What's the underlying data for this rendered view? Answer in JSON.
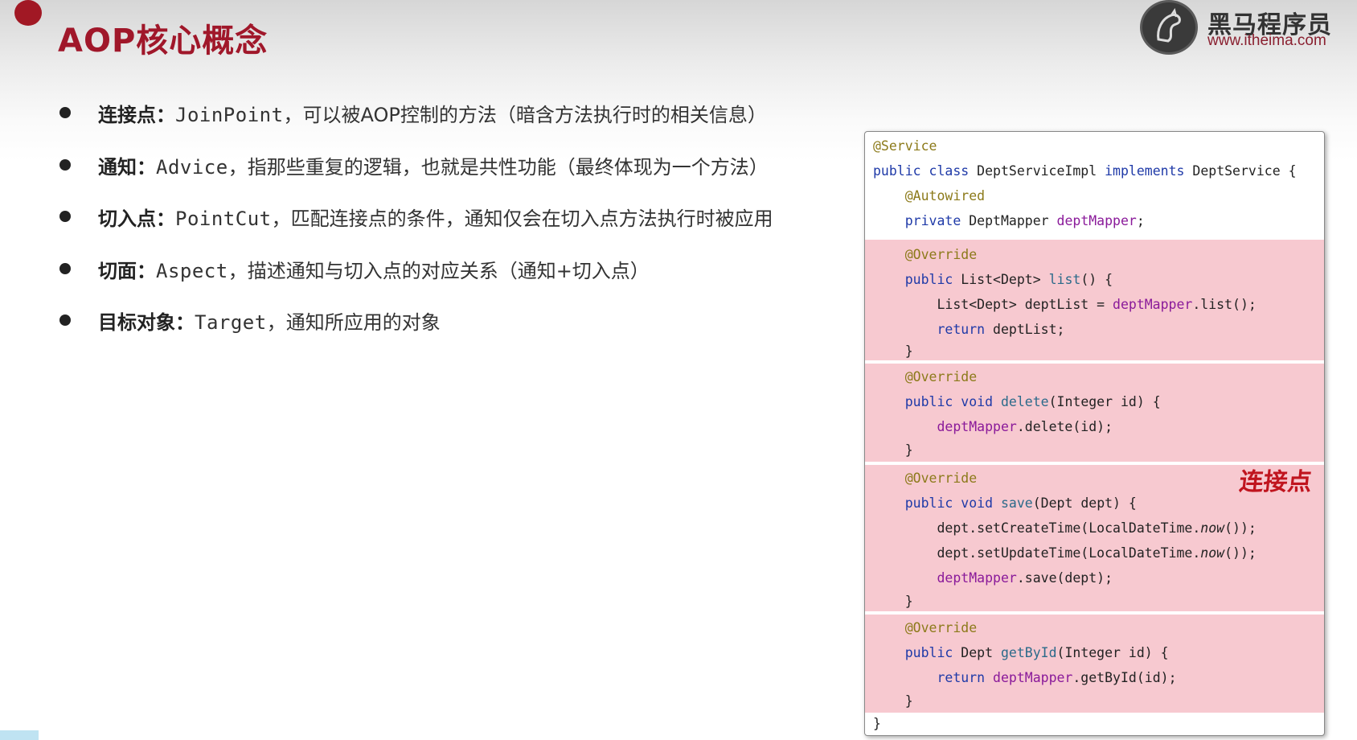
{
  "title": "AOP核心概念",
  "logo": {
    "cn": "黑马程序员",
    "url": "www.itheima.com",
    "icon": "horse-head-icon"
  },
  "bullets": [
    {
      "term": "连接点：",
      "en": "JoinPoint",
      "desc": "，可以被AOP控制的方法（暗含方法执行时的相关信息）"
    },
    {
      "term": "通知：",
      "en": "Advice",
      "desc": "，指那些重复的逻辑，也就是共性功能（最终体现为一个方法）"
    },
    {
      "term": "切入点：",
      "en": "PointCut",
      "desc": "，匹配连接点的条件，通知仅会在切入点方法执行时被应用"
    },
    {
      "term": "切面：",
      "en": "Aspect",
      "desc": "，描述通知与切入点的对应关系（通知+切入点）"
    },
    {
      "term": "目标对象：",
      "en": "Target",
      "desc": "，通知所应用的对象"
    }
  ],
  "code_label": "连接点",
  "colors": {
    "title": "#a0172a",
    "highlight": "#f7c9d0",
    "keyword": "#1f3aa8",
    "annotation": "#8c7a1a",
    "field": "#8a1a9a"
  }
}
